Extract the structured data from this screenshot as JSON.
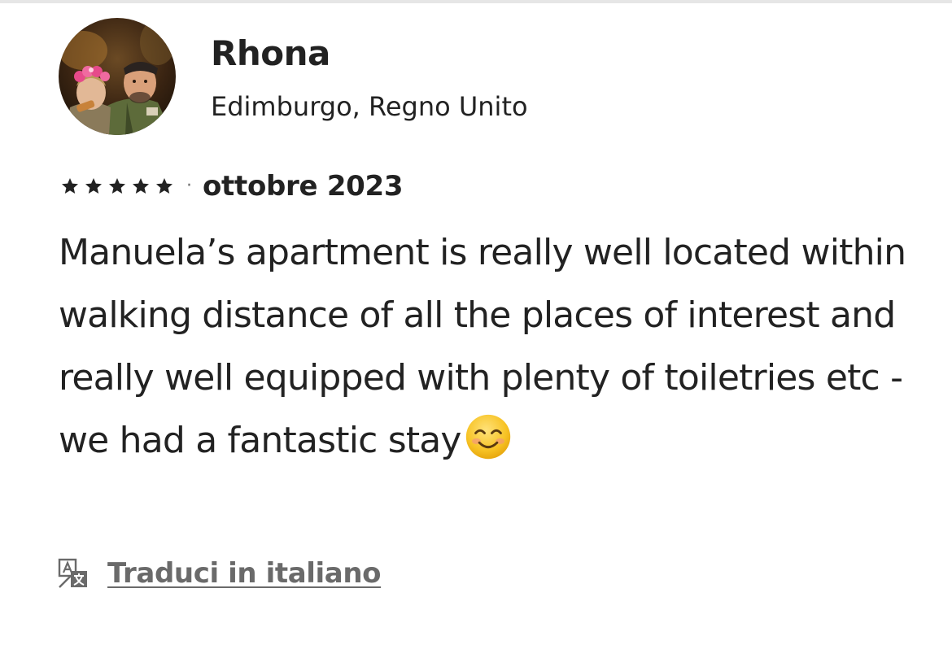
{
  "reviewer": {
    "name": "Rhona",
    "location": "Edimburgo, Regno Unito",
    "avatar": "reviewer-photo"
  },
  "review": {
    "rating": 5,
    "rating_max": 5,
    "separator": "·",
    "date": "ottobre 2023",
    "text": "Manuela’s apartment is really well located within walking distance of all the places of interest and really well equipped with plenty of toiletries etc - we had a fantastic stay",
    "emoji": "smiling-face-emoji"
  },
  "translate": {
    "icon": "translate-icon",
    "label": "Traduci in italiano"
  },
  "colors": {
    "text_primary": "#222222",
    "text_secondary": "#6a6a6a",
    "emoji_yellow": "#f7c325"
  }
}
